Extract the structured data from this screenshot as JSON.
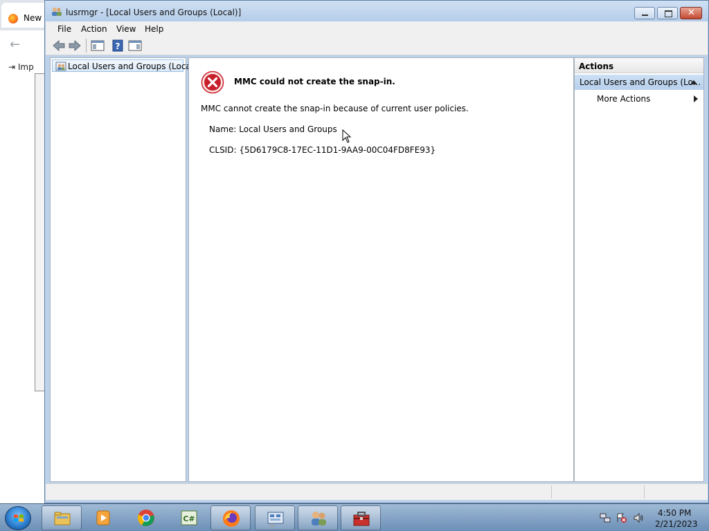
{
  "background_browser": {
    "tab_label": "New T",
    "import_label": "Imp"
  },
  "window": {
    "title": "lusrmgr - [Local Users and Groups (Local)]",
    "close_glyph": "✕"
  },
  "menu": {
    "file": "File",
    "action": "Action",
    "view": "View",
    "help": "Help"
  },
  "tree": {
    "root": "Local Users and Groups (Local)"
  },
  "error": {
    "title": "MMC could not create the snap-in.",
    "message": "MMC cannot create the snap-in because of current user policies.",
    "name_line": "Name: Local Users and Groups",
    "clsid_line": "CLSID: {5D6179C8-17EC-11D1-9AA9-00C04FD8FE93}"
  },
  "actions": {
    "header": "Actions",
    "group_label": "Local Users and Groups (Lo...",
    "more_actions": "More Actions"
  },
  "taskbar": {
    "apps": [
      "explorer-icon",
      "media-player-icon",
      "chrome-icon",
      "csharp-icon",
      "firefox-icon",
      "control-panel-icon",
      "users-icon",
      "toolbox-icon"
    ],
    "time": "4:50 PM",
    "date": "2/21/2023"
  },
  "colors": {
    "error_red": "#c8202a",
    "selection_blue": "#cde0f4",
    "titlebar": "#cfe0f3"
  }
}
